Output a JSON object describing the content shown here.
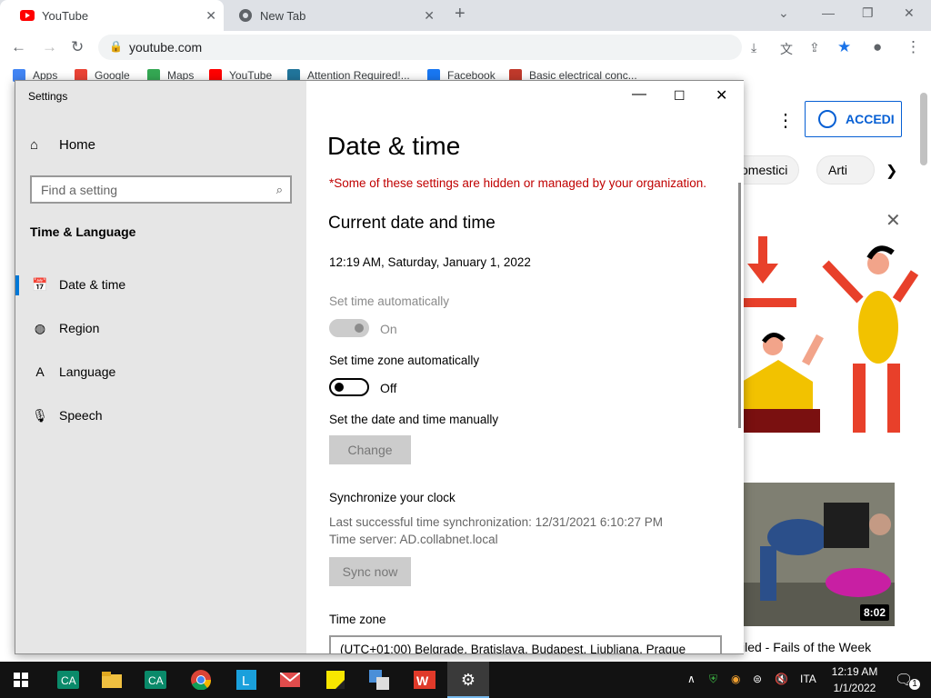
{
  "browser": {
    "tabs": [
      {
        "title": "YouTube",
        "icon": "youtube-icon"
      },
      {
        "title": "New Tab",
        "icon": "chrome-icon"
      }
    ],
    "url": "youtube.com",
    "bookmarks": [
      {
        "label": "Apps",
        "color": "#4285f4"
      },
      {
        "label": "Google",
        "color": "#ea4335"
      },
      {
        "label": "Maps",
        "color": "#34a853"
      },
      {
        "label": "YouTube",
        "color": "#ff0000"
      },
      {
        "label": "Attention Required!...",
        "color": "#21759b"
      },
      {
        "label": "Facebook",
        "color": "#1877f2"
      },
      {
        "label": "Basic electrical conc...",
        "color": "#c0392b"
      }
    ]
  },
  "youtube": {
    "signin_label": "ACCEDI",
    "chips": [
      "omestici",
      "Arti"
    ],
    "video_duration": "8:02",
    "video_title": "iled - Fails of the Week"
  },
  "settings": {
    "window_title": "Settings",
    "home_label": "Home",
    "search_placeholder": "Find a setting",
    "section_title": "Time & Language",
    "nav": [
      {
        "label": "Date & time",
        "icon": "calendar-clock-icon",
        "selected": true
      },
      {
        "label": "Region",
        "icon": "globe-icon",
        "selected": false
      },
      {
        "label": "Language",
        "icon": "language-icon",
        "selected": false
      },
      {
        "label": "Speech",
        "icon": "microphone-icon",
        "selected": false
      }
    ],
    "page_title": "Date & time",
    "managed_warning": "*Some of these settings are hidden or managed by your organization.",
    "current_heading": "Current date and time",
    "current_datetime": "12:19 AM, Saturday, January 1, 2022",
    "set_time_auto_label": "Set time automatically",
    "set_time_auto_state": "On",
    "set_tz_auto_label": "Set time zone automatically",
    "set_tz_auto_state": "Off",
    "manual_label": "Set the date and time manually",
    "change_button": "Change",
    "sync_heading": "Synchronize your clock",
    "last_sync": "Last successful time synchronization: 12/31/2021 6:10:27 PM",
    "time_server": "Time server: AD.collabnet.local",
    "sync_button": "Sync now",
    "timezone_label": "Time zone",
    "timezone_value": "(UTC+01:00) Belgrade, Bratislava, Budapest, Ljubljana, Prague"
  },
  "taskbar": {
    "language": "ITA",
    "time": "12:19 AM",
    "date": "1/1/2022",
    "notifications": "1"
  }
}
